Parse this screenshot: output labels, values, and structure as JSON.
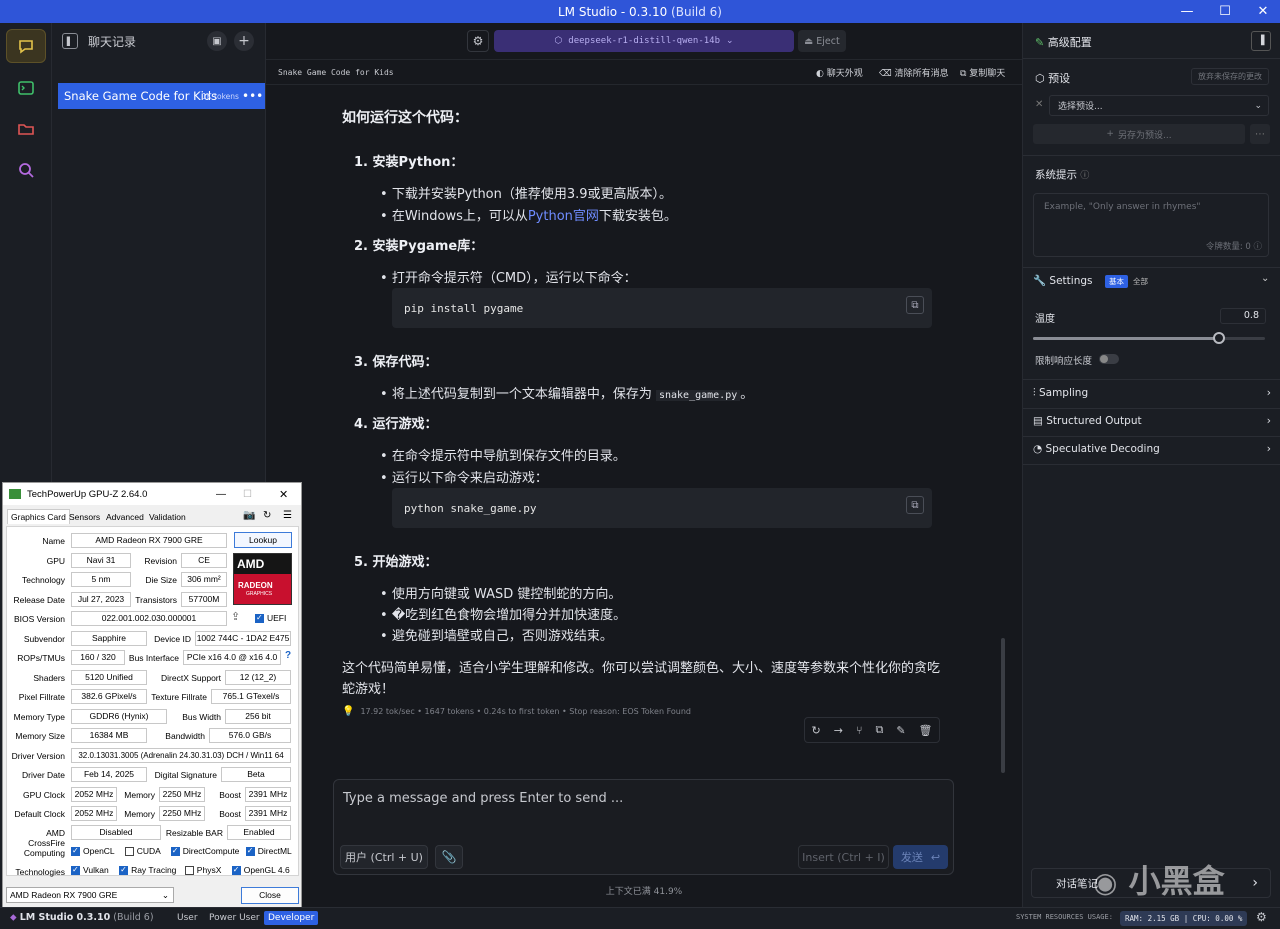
{
  "window": {
    "title": "LM Studio",
    "version": "- 0.3.10",
    "build": "(Build 6)"
  },
  "sidebar": {
    "title": "聊天记录",
    "chat": {
      "name": "Snake Game Code for Kids",
      "tokens": "1K tokens"
    }
  },
  "topbar": {
    "model": "deepseek-r1-distill-qwen-14b",
    "eject": "Eject"
  },
  "subbar": {
    "chat_title": "Snake Game Code for Kids",
    "appearance": "聊天外观",
    "clear": "清除所有消息",
    "copy": "复制聊天"
  },
  "message": {
    "heading": "如何运行这个代码：",
    "s1_title": "1. 安装Python：",
    "s1_b1": "下载并安装Python（推荐使用3.9或更高版本）。",
    "s1_b2_pre": "在Windows上，可以从",
    "s1_b2_link": "Python官网",
    "s1_b2_post": "下载安装包。",
    "s2_title": "2. 安装Pygame库：",
    "s2_b1": "打开命令提示符（CMD），运行以下命令：",
    "code1": "pip install pygame",
    "s3_title": "3. 保存代码：",
    "s3_b1_pre": "将上述代码复制到一个文本编辑器中，保存为",
    "s3_b1_code": "snake_game.py",
    "s3_b1_post": "。",
    "s4_title": "4. 运行游戏：",
    "s4_b1": "在命令提示符中导航到保存文件的目录。",
    "s4_b2": "运行以下命令来启动游戏：",
    "code2": "python snake_game.py",
    "s5_title": "5. 开始游戏：",
    "s5_b1": "使用方向键或 WASD 键控制蛇的方向。",
    "s5_b2": "�吃到红色食物会增加得分并加快速度。",
    "s5_b3": "避免碰到墙壁或自己，否则游戏结束。",
    "closing": "这个代码简单易懂，适合小学生理解和修改。你可以尝试调整颜色、大小、速度等参数来个性化你的贪吃蛇游戏！",
    "stats": "17.92 tok/sec • 1647 tokens • 0.24s to first token • Stop reason: EOS Token Found"
  },
  "input": {
    "placeholder": "Type a message and press Enter to send ...",
    "role": "用户 (Ctrl + U)",
    "insert": "Insert (Ctrl + I)",
    "send": "发送",
    "context": "上下文已满 41.9%"
  },
  "right": {
    "title": "高级配置",
    "preset_label": "预设",
    "discard": "放弃未保存的更改",
    "preset_select": "选择预设...",
    "save_as": "另存为预设...",
    "system_prompt": "系统提示",
    "system_placeholder": "Example, \"Only answer in rhymes\"",
    "token_count": "令牌数量: 0",
    "settings": "Settings",
    "tag_basic": "基本",
    "tag_all": "全部",
    "temperature": "温度",
    "temp_value": "0.8",
    "temp_fraction": 0.8,
    "limit_length": "限制响应长度",
    "sampling": "Sampling",
    "structured": "Structured Output",
    "speculative": "Speculative Decoding",
    "notes": "对话笔记"
  },
  "gpuz": {
    "title": "TechPowerUp GPU-Z 2.64.0",
    "tabs": [
      "Graphics Card",
      "Sensors",
      "Advanced",
      "Validation"
    ],
    "lookup": "Lookup",
    "uefi": "UEFI",
    "labels": {
      "name": "Name",
      "gpu": "GPU",
      "revision": "Revision",
      "technology": "Technology",
      "die_size": "Die Size",
      "release": "Release Date",
      "transistors": "Transistors",
      "bios": "BIOS Version",
      "subvendor": "Subvendor",
      "device_id": "Device ID",
      "rops": "ROPs/TMUs",
      "bus": "Bus Interface",
      "shaders": "Shaders",
      "directx": "DirectX Support",
      "pixel": "Pixel Fillrate",
      "texture": "Texture Fillrate",
      "memtype": "Memory Type",
      "buswidth": "Bus Width",
      "memsize": "Memory Size",
      "bandwidth": "Bandwidth",
      "driver": "Driver Version",
      "driverdate": "Driver Date",
      "digsig": "Digital Signature",
      "gpuclock": "GPU Clock",
      "memory": "Memory",
      "boost": "Boost",
      "defclock": "Default Clock",
      "crossfire": "AMD CrossFire",
      "resizable": "Resizable BAR",
      "computing": "Computing",
      "technologies": "Technologies"
    },
    "values": {
      "name": "AMD Radeon RX 7900 GRE",
      "gpu": "Navi 31",
      "revision": "CE",
      "technology": "5 nm",
      "die_size": "306 mm²",
      "release": "Jul 27, 2023",
      "transistors": "57700M",
      "bios": "022.001.002.030.000001",
      "subvendor": "Sapphire",
      "device_id": "1002 744C - 1DA2 E475",
      "rops": "160 / 320",
      "bus": "PCIe x16 4.0 @ x16 4.0",
      "shaders": "5120 Unified",
      "directx": "12 (12_2)",
      "pixel": "382.6 GPixel/s",
      "texture": "765.1 GTexel/s",
      "memtype": "GDDR6 (Hynix)",
      "buswidth": "256 bit",
      "memsize": "16384 MB",
      "bandwidth": "576.0 GB/s",
      "driver": "32.0.13031.3005 (Adrenalin 24.30.31.03) DCH / Win11 64",
      "driverdate": "Feb 14, 2025",
      "digsig": "Beta",
      "gpuclock": "2052 MHz",
      "gpumem": "2250 MHz",
      "gpuboost": "2391 MHz",
      "defclock": "2052 MHz",
      "defmem": "2250 MHz",
      "defboost": "2391 MHz",
      "crossfire": "Disabled",
      "resizable": "Enabled"
    },
    "computing": [
      "OpenCL",
      "CUDA",
      "DirectCompute",
      "DirectML"
    ],
    "technologies": [
      "Vulkan",
      "Ray Tracing",
      "PhysX",
      "OpenGL 4.6"
    ],
    "select": "AMD Radeon RX 7900 GRE",
    "close": "Close",
    "logo_top": "AMD",
    "logo_mid": "RADEON",
    "logo_bot": "GRAPHICS",
    "help": "?"
  },
  "status": {
    "app": "LM Studio 0.3.10",
    "build": "(Build 6)",
    "modes": [
      "User",
      "Power User",
      "Developer"
    ],
    "sys": "SYSTEM RESOURCES USAGE:",
    "ram": "RAM: 2.15 GB",
    "cpu": "CPU: 0.00 %"
  },
  "watermark": "小黑盒",
  "colors": {
    "accent": "#2e61e3",
    "link": "#6f8cff"
  }
}
